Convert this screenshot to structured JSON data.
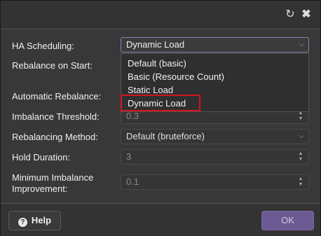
{
  "titlebar": {
    "reset_icon": "reset-icon",
    "close_icon": "close-icon"
  },
  "fields": [
    {
      "label": "HA Scheduling:",
      "value": "Dynamic Load",
      "type": "select"
    },
    {
      "label": "Rebalance on Start:",
      "value": "",
      "type": "select"
    },
    {
      "label": "Automatic Rebalance:",
      "value": "",
      "type": "select"
    },
    {
      "label": "Imbalance Threshold:",
      "value": "0.3",
      "type": "number"
    },
    {
      "label": "Rebalancing Method:",
      "value": "Default (bruteforce)",
      "type": "select"
    },
    {
      "label": "Hold Duration:",
      "value": "3",
      "type": "number"
    },
    {
      "label": "Minimum Imbalance Improvement:",
      "value": "0.1",
      "type": "number"
    }
  ],
  "dropdown": {
    "options": [
      "Default (basic)",
      "Basic (Resource Count)",
      "Static Load",
      "Dynamic Load"
    ],
    "highlighted": "Dynamic Load"
  },
  "footer": {
    "help_label": "Help",
    "ok_label": "OK"
  },
  "colors": {
    "highlight_border": "#d4141c",
    "ok_button": "#6c5a94"
  }
}
